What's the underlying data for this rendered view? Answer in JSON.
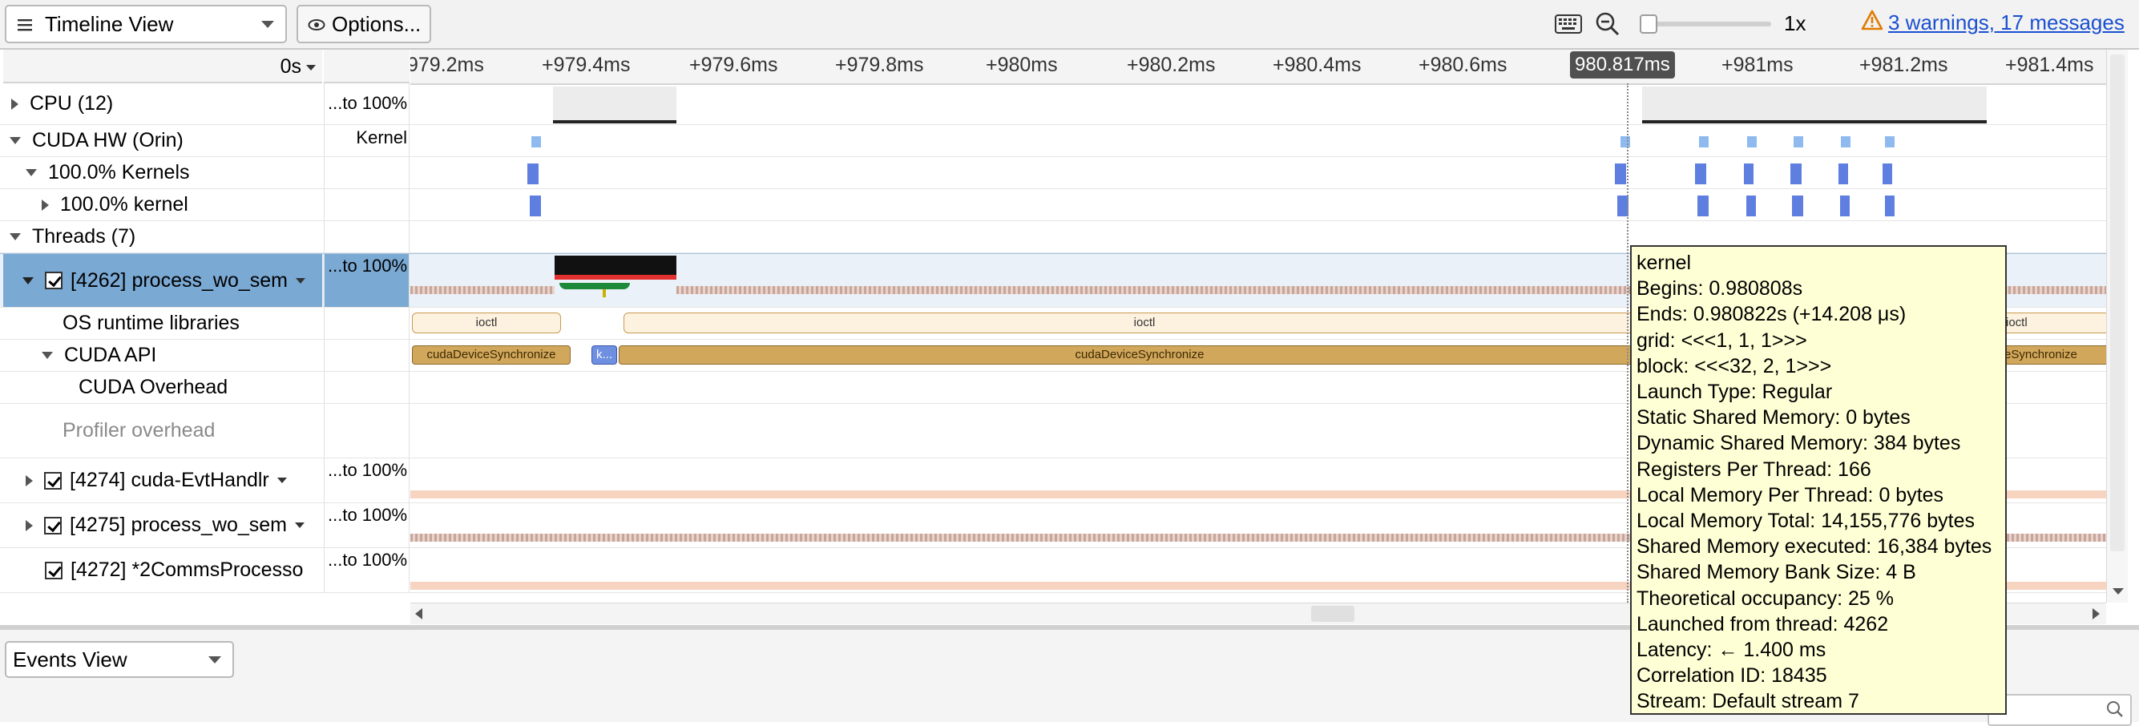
{
  "toolbar": {
    "view_select": "Timeline View",
    "options_label": "Options...",
    "zoom_level": "1x",
    "warnings_link": "3 warnings, 17 messages",
    "slider_value": 0.0
  },
  "ruler": {
    "start_select": "0s",
    "ticks": [
      "979.2ms",
      "+979.4ms",
      "+979.6ms",
      "+979.8ms",
      "+980ms",
      "+980.2ms",
      "+980.4ms",
      "+980.6ms",
      "+981ms",
      "+981.2ms",
      "+981.4ms"
    ],
    "cursor_label": "980.817ms"
  },
  "rows": {
    "cpu": {
      "label": "CPU (12)",
      "mid": "...to 100%"
    },
    "cuda_hw": {
      "label": "CUDA HW (Orin)",
      "mid": "Kernel"
    },
    "kernels_pct": {
      "label": "100.0% Kernels"
    },
    "kernel_pct": {
      "label": "100.0% kernel"
    },
    "threads": {
      "label": "Threads (7)"
    },
    "thread_4262": {
      "label": "[4262] process_wo_sem",
      "mid": "...to 100%"
    },
    "os_runtime": {
      "label": "OS runtime libraries",
      "ioctl1": "ioctl",
      "ioctl2": "ioctl",
      "ioctl3": "ioctl"
    },
    "cuda_api": {
      "label": "CUDA API",
      "sync1": "cudaDeviceSynchronize",
      "k_short": "k...",
      "sync2": "cudaDeviceSynchronize",
      "sync3": "eSynchronize"
    },
    "cuda_overhead": {
      "label": "CUDA Overhead"
    },
    "profiler_overhead": {
      "label": "Profiler overhead"
    },
    "thread_4274": {
      "label": "[4274] cuda-EvtHandlr",
      "mid": "...to 100%"
    },
    "thread_4275": {
      "label": "[4275] process_wo_sem",
      "mid": "...to 100%"
    },
    "thread_4272": {
      "label": "[4272] *2CommsProcesso",
      "mid": "...to 100%"
    }
  },
  "tooltip": {
    "title": "kernel",
    "lines": [
      "Begins: 0.980808s",
      "Ends: 0.980822s (+14.208 μs)",
      "grid:  <<<1, 1, 1>>>",
      "block: <<<32, 2, 1>>>",
      "Launch Type: Regular",
      "Static Shared Memory: 0 bytes",
      "Dynamic Shared Memory: 384 bytes",
      "Registers Per Thread: 166",
      "Local Memory Per Thread: 0 bytes",
      "Local Memory Total: 14,155,776 bytes",
      "Shared Memory executed: 16,384 bytes",
      "Shared Memory Bank Size: 4 B",
      "Theoretical occupancy: 25 %",
      "Launched from thread: 4262",
      "Latency: ← 1.400 ms",
      "Correlation ID: 18435",
      "Stream: Default stream 7"
    ]
  },
  "bottom": {
    "events_select": "Events View"
  },
  "colors": {
    "selected_row": "#7aa9d4",
    "kernel": "#5f7fe0",
    "api": "#d1a75c",
    "tooltip_bg": "#ffffd6",
    "warning": "#e07b00",
    "link": "#1a4fd0"
  }
}
